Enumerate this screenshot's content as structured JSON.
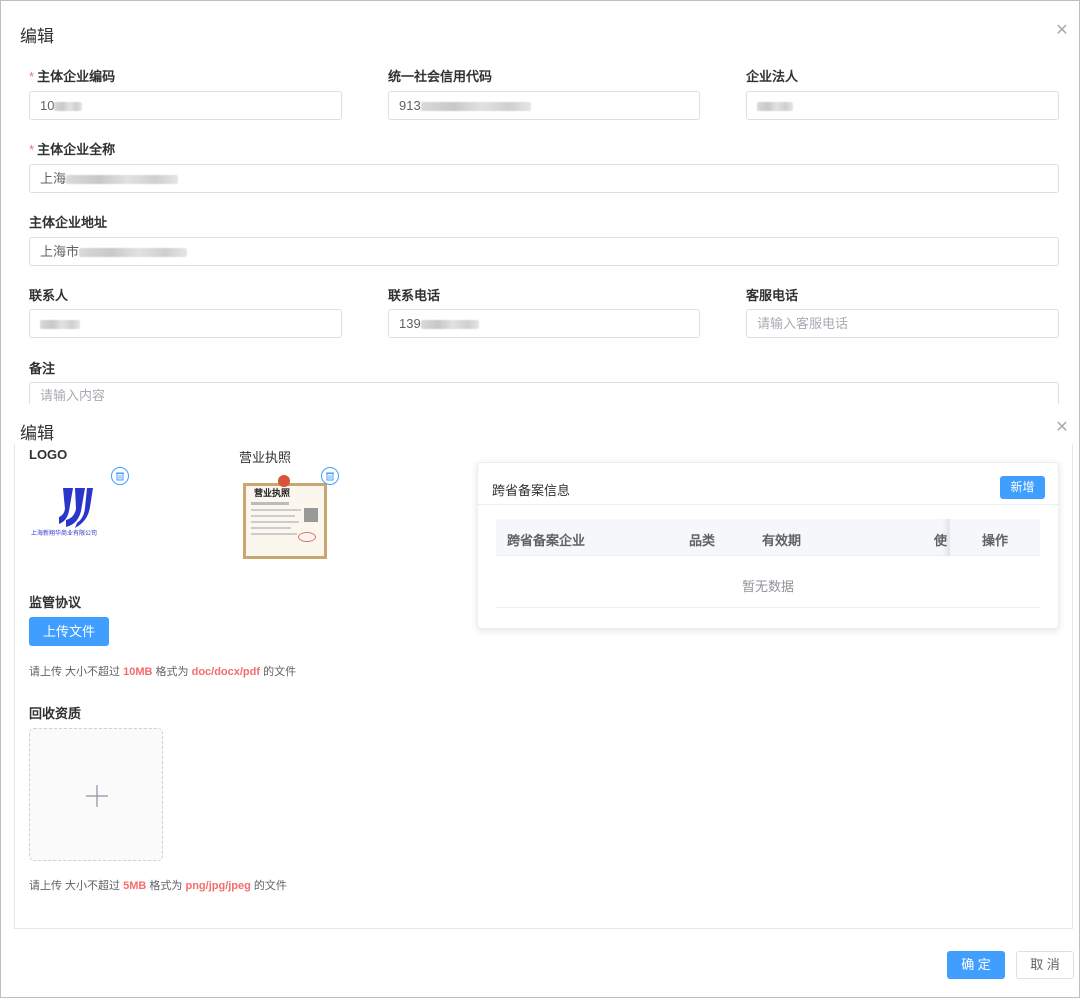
{
  "dialog_top": {
    "title": "编辑",
    "close_icon": "close-icon"
  },
  "form": {
    "main_code": {
      "label": "主体企业编码",
      "value_prefix": "10"
    },
    "credit_code": {
      "label": "统一社会信用代码",
      "value_prefix": "913"
    },
    "legal_person": {
      "label": "企业法人"
    },
    "full_name": {
      "label": "主体企业全称",
      "value_prefix": "上海"
    },
    "address": {
      "label": "主体企业地址",
      "value_prefix": "上海市"
    },
    "contact": {
      "label": "联系人"
    },
    "phone": {
      "label": "联系电话",
      "value_prefix": "139"
    },
    "service_phone": {
      "label": "客服电话",
      "placeholder": "请输入客服电话"
    },
    "remark": {
      "label": "备注",
      "placeholder": "请输入内容"
    }
  },
  "dialog_bottom": {
    "title": "编辑",
    "close_icon": "close-icon"
  },
  "uploads": {
    "logo_label": "LOGO",
    "logo_caption": "上海新翔华商业有限公司",
    "license_label": "营业执照",
    "license_caption": "营业执照",
    "agreement_label": "监管协议",
    "upload_button": "上传文件",
    "agreement_hint": {
      "prefix": "请上传  大小不超过 ",
      "size": "10MB",
      "mid": " 格式为 ",
      "formats": "doc/docx/pdf",
      "suffix": " 的文件"
    },
    "recycle_label": "回收资质",
    "recycle_hint": {
      "prefix": "请上传  大小不超过 ",
      "size": "5MB",
      "mid": " 格式为 ",
      "formats": "png/jpg/jpeg",
      "suffix": " 的文件"
    }
  },
  "record_card": {
    "title": "跨省备案信息",
    "add_button": "新增",
    "columns": [
      "跨省备案企业",
      "品类",
      "有效期",
      "使",
      "操作"
    ],
    "empty_text": "暂无数据"
  },
  "footer": {
    "confirm": "确 定",
    "cancel": "取 消"
  },
  "colors": {
    "primary": "#409eff",
    "danger": "#f56c6c",
    "logo_blue": "#2a36c9"
  }
}
